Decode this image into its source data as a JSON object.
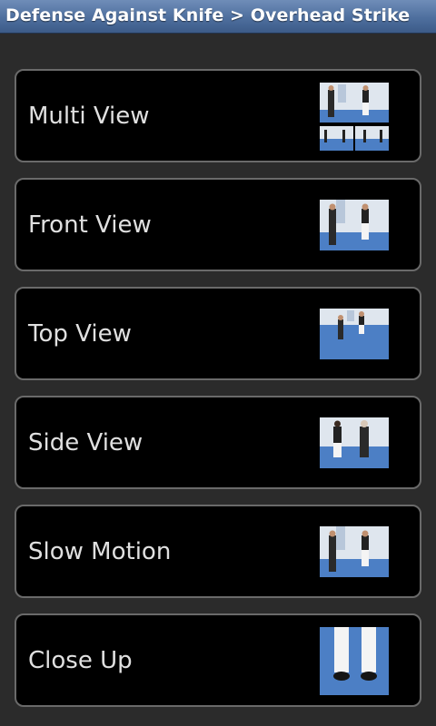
{
  "header": {
    "title": "Defense Against Knife > Overhead Strike"
  },
  "items": [
    {
      "label": "Multi View",
      "thumb": "multi-view-thumbnail"
    },
    {
      "label": "Front View",
      "thumb": "front-view-thumbnail"
    },
    {
      "label": "Top View",
      "thumb": "top-view-thumbnail"
    },
    {
      "label": "Side View",
      "thumb": "side-view-thumbnail"
    },
    {
      "label": "Slow Motion",
      "thumb": "slow-motion-thumbnail"
    },
    {
      "label": "Close Up",
      "thumb": "close-up-thumbnail"
    }
  ],
  "colors": {
    "title_bar": "#4e6f9e",
    "item_border": "#6a6a6a",
    "item_bg": "#000000",
    "label": "#e0e0e0"
  }
}
